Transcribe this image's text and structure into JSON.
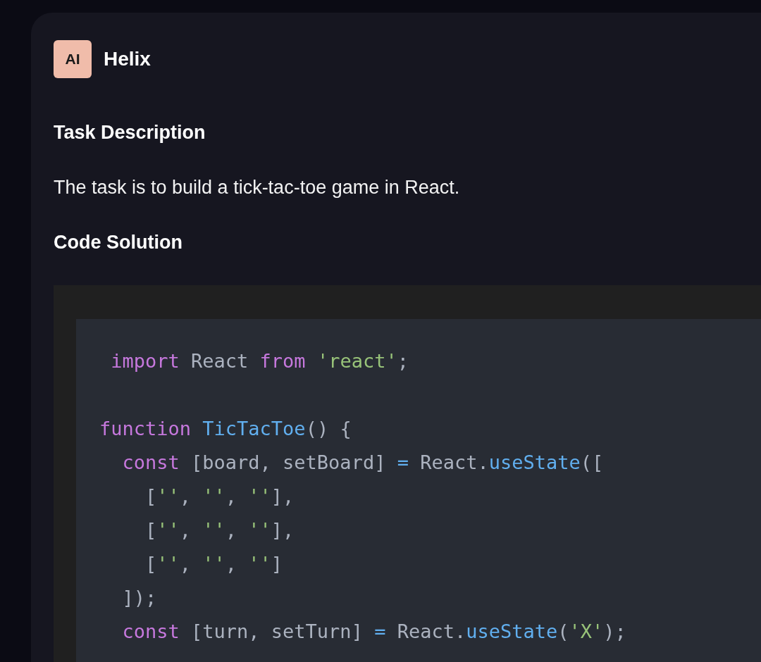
{
  "message": {
    "avatar": "AI",
    "author": "Helix"
  },
  "sections": [
    {
      "kind": "heading",
      "text": "Task Description"
    },
    {
      "kind": "paragraph",
      "text": "The task is to build a tick-tac-toe game in React."
    },
    {
      "kind": "heading",
      "text": "Code Solution"
    }
  ],
  "code_lines": [
    {
      "kind": "code",
      "tokens": [
        {
          "text": " import",
          "kind": "keyword"
        },
        {
          "text": " React ",
          "kind": "plain"
        },
        {
          "text": "from ",
          "kind": "keyword"
        },
        {
          "text": "'react'",
          "kind": "string"
        },
        {
          "text": ";",
          "kind": "plain"
        }
      ]
    },
    {
      "kind": "blank"
    },
    {
      "kind": "code",
      "tokens": [
        {
          "text": "function ",
          "kind": "keyword"
        },
        {
          "text": "TicTacToe",
          "kind": "function"
        },
        {
          "text": "() {",
          "kind": "plain"
        }
      ]
    },
    {
      "kind": "code",
      "tokens": [
        {
          "text": "  const",
          "kind": "keyword"
        },
        {
          "text": " [board, setBoard] ",
          "kind": "plain"
        },
        {
          "text": "=",
          "kind": "operator"
        },
        {
          "text": " React.",
          "kind": "plain"
        },
        {
          "text": "useState",
          "kind": "function"
        },
        {
          "text": "([",
          "kind": "plain"
        }
      ]
    },
    {
      "kind": "code",
      "tokens": [
        {
          "text": "    [",
          "kind": "plain"
        },
        {
          "text": "''",
          "kind": "string"
        },
        {
          "text": ", ",
          "kind": "plain"
        },
        {
          "text": "''",
          "kind": "string"
        },
        {
          "text": ", ",
          "kind": "plain"
        },
        {
          "text": "''",
          "kind": "string"
        },
        {
          "text": "],",
          "kind": "plain"
        }
      ]
    },
    {
      "kind": "code",
      "tokens": [
        {
          "text": "    [",
          "kind": "plain"
        },
        {
          "text": "''",
          "kind": "string"
        },
        {
          "text": ", ",
          "kind": "plain"
        },
        {
          "text": "''",
          "kind": "string"
        },
        {
          "text": ", ",
          "kind": "plain"
        },
        {
          "text": "''",
          "kind": "string"
        },
        {
          "text": "],",
          "kind": "plain"
        }
      ]
    },
    {
      "kind": "code",
      "tokens": [
        {
          "text": "    [",
          "kind": "plain"
        },
        {
          "text": "''",
          "kind": "string"
        },
        {
          "text": ", ",
          "kind": "plain"
        },
        {
          "text": "''",
          "kind": "string"
        },
        {
          "text": ", ",
          "kind": "plain"
        },
        {
          "text": "''",
          "kind": "string"
        },
        {
          "text": "]",
          "kind": "plain"
        }
      ]
    },
    {
      "kind": "code",
      "tokens": [
        {
          "text": "  ]);",
          "kind": "plain"
        }
      ]
    },
    {
      "kind": "code",
      "tokens": [
        {
          "text": "  const",
          "kind": "keyword"
        },
        {
          "text": " [turn, setTurn] ",
          "kind": "plain"
        },
        {
          "text": "=",
          "kind": "operator"
        },
        {
          "text": " React.",
          "kind": "plain"
        },
        {
          "text": "useState",
          "kind": "function"
        },
        {
          "text": "(",
          "kind": "plain"
        },
        {
          "text": "'X'",
          "kind": "string"
        },
        {
          "text": ");",
          "kind": "plain"
        }
      ]
    }
  ]
}
